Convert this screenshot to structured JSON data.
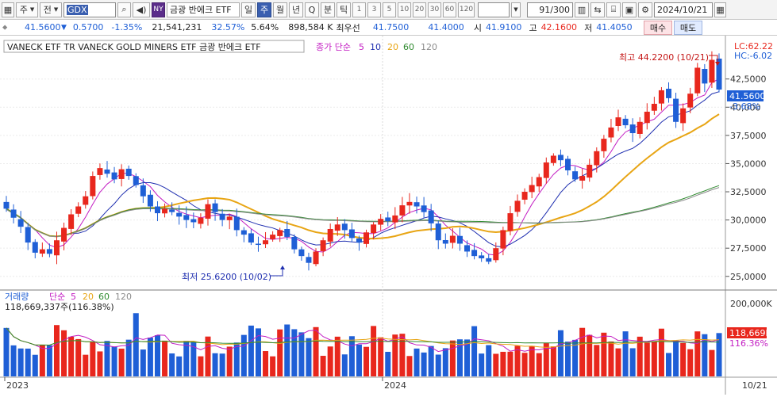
{
  "toolbar": {
    "market_type": "주",
    "market_scope": "전",
    "ticker": "GDX",
    "nasdaq_badge": "NY",
    "name": "금광 반에크 ETF",
    "periods": [
      "일",
      "주",
      "월",
      "년",
      "Q"
    ],
    "active_period": "주",
    "minute_tick": [
      "분",
      "틱"
    ],
    "intervals": [
      "1",
      "3",
      "5",
      "10",
      "20",
      "30",
      "60",
      "120"
    ],
    "count": "91",
    "count_total": "/300",
    "date": "2024/10/21"
  },
  "quote": {
    "price": "41.5600",
    "change_arrow": "▼",
    "change": "0.5700",
    "change_pct": "-1.35%",
    "volume": "21,541,231",
    "volume_pct": "32.57%",
    "turnover": "5.64%",
    "amount": "898,584 K",
    "best_bid_label": "최우선",
    "best_ask": "41.7500",
    "best_bid": "41.4000",
    "open_label": "시",
    "open": "41.9100",
    "high_label": "고",
    "high": "42.1600",
    "low_label": "저",
    "low": "41.4050",
    "buy_label": "매수",
    "sell_label": "매도"
  },
  "price_panel": {
    "title": "VANECK ETF TR VANECK GOLD MINERS ETF  금광 반에크 ETF",
    "ma_label": "종가 단순",
    "ma_periods": [
      "5",
      "10",
      "20",
      "60",
      "120"
    ],
    "lc_label": "LC:62.22",
    "hc_label": "HC:-6.02",
    "high_annotation": "최고 44.2200 (10/21)",
    "low_annotation": "최저 25.6200 (10/02)",
    "current_price_tag": "41.5600",
    "current_pct_tag": "-3.68%",
    "y_ticks": [
      "42,5000",
      "40,000",
      "37,5000",
      "35,0000",
      "32,5000",
      "30,0000",
      "27,5000",
      "25,0000"
    ]
  },
  "volume_panel": {
    "label": "거래량",
    "ma_label": "단순",
    "ma_periods": [
      "5",
      "20",
      "60",
      "120"
    ],
    "readout": "118,669,337주(116.38%)",
    "y_tick": "200,000K",
    "volume_tag": "118,669K",
    "pct_tag": "116.36%"
  },
  "x_axis": {
    "labels": [
      "2023",
      "2024",
      "10/21"
    ]
  },
  "colors": {
    "up": "#e8271d",
    "down": "#1f5fd6",
    "ma5": "#c31ec3",
    "ma10": "#1f2fb0",
    "ma20": "#e8a514",
    "ma60": "#2f8a2f",
    "ma120": "#8c8c8c",
    "accent": "#3a5fb0"
  },
  "chart_data": {
    "type": "candlestick",
    "title": "VANECK ETF TR VANECK GOLD MINERS ETF  금광 반에크 ETF",
    "ylim": [
      24000,
      45500
    ],
    "x_range": [
      "2023",
      "10/21"
    ],
    "closes": [
      31000,
      30200,
      29400,
      28000,
      27100,
      27400,
      27000,
      28200,
      29300,
      30500,
      31200,
      32100,
      33900,
      34600,
      34100,
      33600,
      34500,
      33900,
      33100,
      32100,
      31200,
      30600,
      31000,
      30700,
      30300,
      30000,
      29800,
      30200,
      31400,
      30700,
      30000,
      30300,
      29100,
      28700,
      28000,
      27800,
      28200,
      28700,
      29100,
      28500,
      27400,
      26800,
      26200,
      27200,
      28200,
      29200,
      29600,
      29100,
      28400,
      28000,
      28900,
      29600,
      30100,
      29900,
      30400,
      31300,
      31600,
      31200,
      30700,
      29700,
      28200,
      27900,
      28600,
      27900,
      27200,
      26800,
      26600,
      26300,
      27500,
      29100,
      30600,
      31700,
      32500,
      33100,
      33800,
      35100,
      35700,
      35300,
      34400,
      33600,
      33900,
      34900,
      36100,
      37200,
      38200,
      39100,
      38400,
      37700,
      38700,
      39600,
      40300,
      41500,
      40800,
      38700,
      39900,
      41200,
      43500,
      42100,
      44200,
      41560
    ],
    "up_color": "#e8271d",
    "down_color": "#1f5fd6"
  }
}
